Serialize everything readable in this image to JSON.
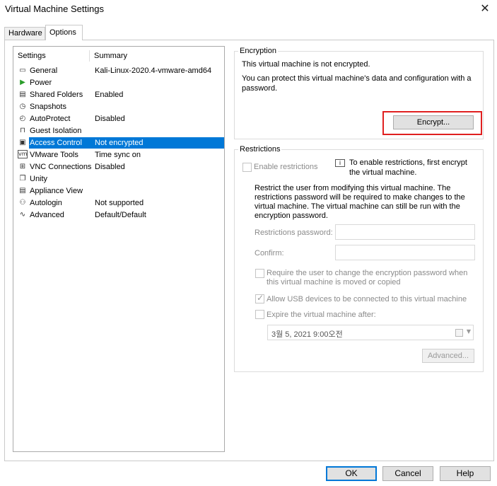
{
  "window": {
    "title": "Virtual Machine Settings",
    "close_glyph": "✕"
  },
  "tabs": [
    {
      "label": "Hardware"
    },
    {
      "label": "Options"
    }
  ],
  "settings_list": {
    "header": {
      "settings": "Settings",
      "summary": "Summary"
    },
    "items": [
      {
        "name": "General",
        "summary": "Kali-Linux-2020.4-vmware-amd64",
        "icon": "general-icon",
        "glyph": "▭"
      },
      {
        "name": "Power",
        "summary": "",
        "icon": "power-icon",
        "glyph": "▶"
      },
      {
        "name": "Shared Folders",
        "summary": "Enabled",
        "icon": "shared-folders-icon",
        "glyph": "▤"
      },
      {
        "name": "Snapshots",
        "summary": "",
        "icon": "snapshots-icon",
        "glyph": "◷"
      },
      {
        "name": "AutoProtect",
        "summary": "Disabled",
        "icon": "autoprotect-icon",
        "glyph": "◴"
      },
      {
        "name": "Guest Isolation",
        "summary": "",
        "icon": "lock-icon",
        "glyph": "⊓"
      },
      {
        "name": "Access Control",
        "summary": "Not encrypted",
        "icon": "access-control-icon",
        "glyph": "▣"
      },
      {
        "name": "VMware Tools",
        "summary": "Time sync on",
        "icon": "vmware-tools-icon",
        "glyph": "vm"
      },
      {
        "name": "VNC Connections",
        "summary": "Disabled",
        "icon": "vnc-icon",
        "glyph": "⊞"
      },
      {
        "name": "Unity",
        "summary": "",
        "icon": "unity-icon",
        "glyph": "❐"
      },
      {
        "name": "Appliance View",
        "summary": "",
        "icon": "appliance-view-icon",
        "glyph": "▤"
      },
      {
        "name": "Autologin",
        "summary": "Not supported",
        "icon": "autologin-icon",
        "glyph": "⚇"
      },
      {
        "name": "Advanced",
        "summary": "Default/Default",
        "icon": "advanced-icon",
        "glyph": "∿"
      }
    ],
    "selected": "Access Control"
  },
  "encryption": {
    "legend": "Encryption",
    "status": "This virtual machine is not encrypted.",
    "description": "You can protect this virtual machine's data and configuration with a password.",
    "encrypt_button": "Encrypt..."
  },
  "restrictions": {
    "legend": "Restrictions",
    "enable_label": "Enable restrictions",
    "info_text": "To enable restrictions, first encrypt the virtual machine.",
    "description": "Restrict the user from modifying this virtual machine. The restrictions password will be required to make changes to the virtual machine. The virtual machine can still be run with the encryption password.",
    "password_label": "Restrictions password:",
    "confirm_label": "Confirm:",
    "require_change_label": "Require the user to change the encryption password when this virtual machine is moved or copied",
    "allow_usb_label": "Allow USB devices to be connected to this virtual machine",
    "expire_label": "Expire the virtual machine after:",
    "expire_date": "3월  5, 2021   9:00오전",
    "advanced_button": "Advanced..."
  },
  "buttons": {
    "ok": "OK",
    "cancel": "Cancel",
    "help": "Help"
  },
  "colors": {
    "selection": "#0078d7",
    "highlight": "#e02020",
    "power": "#2a9d2a"
  }
}
